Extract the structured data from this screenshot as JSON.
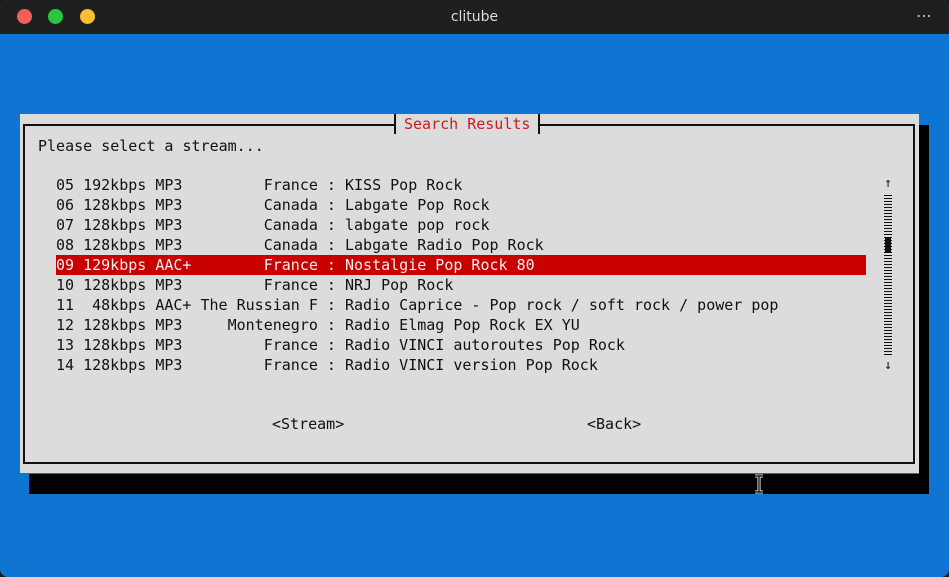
{
  "window": {
    "title": "clitube",
    "menu_glyph": "⋯"
  },
  "dialog": {
    "title": "Search Results",
    "prompt": "Please select a stream...",
    "rows": [
      "05 192kbps MP3         France : KISS Pop Rock",
      "06 128kbps MP3         Canada : Labgate Pop Rock",
      "07 128kbps MP3         Canada : labgate pop rock",
      "08 128kbps MP3         Canada : Labgate Radio Pop Rock",
      "09 129kbps AAC+        France : Nostalgie Pop Rock 80",
      "10 128kbps MP3         France : NRJ Pop Rock",
      "11  48kbps AAC+ The Russian F : Radio Caprice - Pop rock / soft rock / power pop",
      "12 128kbps MP3     Montenegro : Radio Elmag Pop Rock EX YU",
      "13 128kbps MP3         France : Radio VINCI autoroutes Pop Rock",
      "14 128kbps MP3         France : Radio VINCI version Pop Rock"
    ],
    "selected_index": 4,
    "scroll": {
      "up": "↑",
      "down": "↓"
    },
    "buttons": {
      "stream": "<Stream>",
      "back": "<Back>"
    }
  },
  "colors": {
    "terminal_bg": "#0f75d2",
    "dialog_bg": "#dcdcdc",
    "title_text": "#cc1b1b",
    "selected_bg": "#c80000"
  }
}
